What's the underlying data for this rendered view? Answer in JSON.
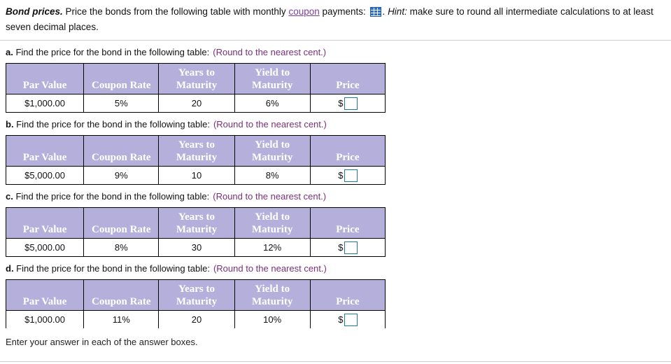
{
  "statement": {
    "title": "Bond prices.",
    "text_before_link": " Price the bonds from the following table with monthly ",
    "link_label": "coupon",
    "text_after_link": " payments:",
    "icon": "table-grid-icon",
    "period_after_icon": ".",
    "hint_label": "Hint:",
    "hint_text": " make sure to round all intermediate calculations to at least seven decimal places."
  },
  "columns": [
    "Par Value",
    "Coupon Rate",
    "Years to Maturity",
    "Yield to Maturity",
    "Price"
  ],
  "column_lines": [
    [
      "",
      "Par Value"
    ],
    [
      "",
      "Coupon Rate"
    ],
    [
      "Years to",
      "Maturity"
    ],
    [
      "Yield to",
      "Maturity"
    ],
    [
      "",
      "Price"
    ]
  ],
  "round_note": "(Round to the nearest cent.)",
  "prompt_text": " Find the price for the bond in the following table:",
  "currency_symbol": "$",
  "answer_placeholder": "",
  "parts": [
    {
      "letter": "a.",
      "par_value": "$1,000.00",
      "coupon_rate": "5%",
      "years_to_maturity": "20",
      "yield_to_maturity": "6%",
      "price_value": ""
    },
    {
      "letter": "b.",
      "par_value": "$5,000.00",
      "coupon_rate": "9%",
      "years_to_maturity": "10",
      "yield_to_maturity": "8%",
      "price_value": ""
    },
    {
      "letter": "c.",
      "par_value": "$5,000.00",
      "coupon_rate": "8%",
      "years_to_maturity": "30",
      "yield_to_maturity": "12%",
      "price_value": ""
    },
    {
      "letter": "d.",
      "par_value": "$1,000.00",
      "coupon_rate": "11%",
      "years_to_maturity": "20",
      "yield_to_maturity": "10%",
      "price_value": ""
    }
  ],
  "footer": {
    "note": "Enter your answer in each of the answer boxes."
  },
  "colors": {
    "header_purple": "#b5afdb",
    "link_purple": "#7b3fa0",
    "note_purple": "#7a2f7a",
    "answer_border_teal": "#1e7b96",
    "icon_blue": "#2f6fd0",
    "divider_gray": "#cfcfcf"
  }
}
